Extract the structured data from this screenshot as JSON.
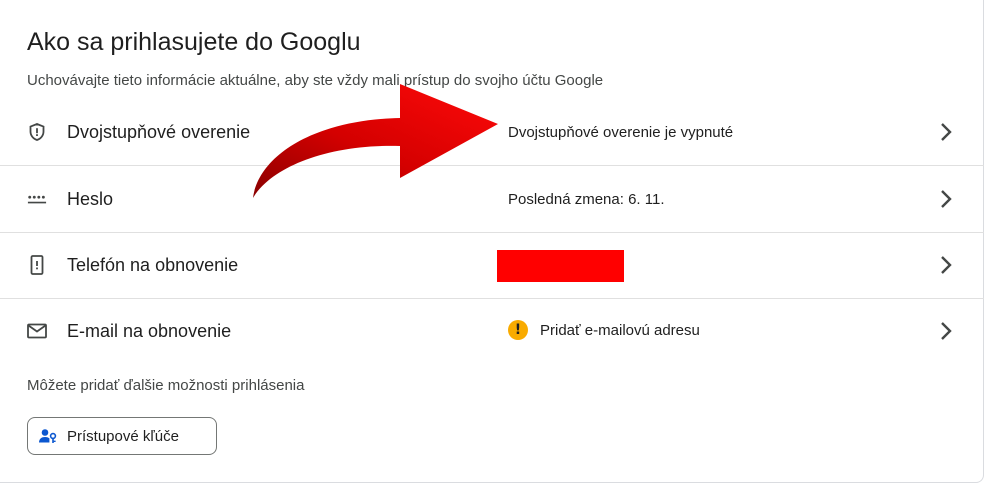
{
  "page": {
    "title": "Ako sa prihlasujete do Googlu",
    "subtitle": "Uchovávajte tieto informácie aktuálne, aby ste vždy mali prístup do svojho účtu Google"
  },
  "rows": [
    {
      "label": "Dvojstupňové overenie",
      "value": "Dvojstupňové overenie je vypnuté",
      "icon": "shield-icon"
    },
    {
      "label": "Heslo",
      "value": "Posledná zmena: 6. 11.",
      "icon": "password-dots-icon"
    },
    {
      "label": "Telefón na obnovenie",
      "value": "",
      "icon": "phone-icon"
    },
    {
      "label": "E-mail na obnovenie",
      "value": "Pridať e-mailovú adresu",
      "icon": "mail-icon"
    }
  ],
  "more_options": "Môžete pridať ďalšie možnosti prihlásenia",
  "passkeys_button": {
    "label": "Prístupové kľúče",
    "icon": "passkey-person-icon"
  },
  "colors": {
    "accent_blue": "#0b57d0",
    "warning": "#f9ab00",
    "annotation_red": "#e00000",
    "redaction": "#ff0000"
  }
}
